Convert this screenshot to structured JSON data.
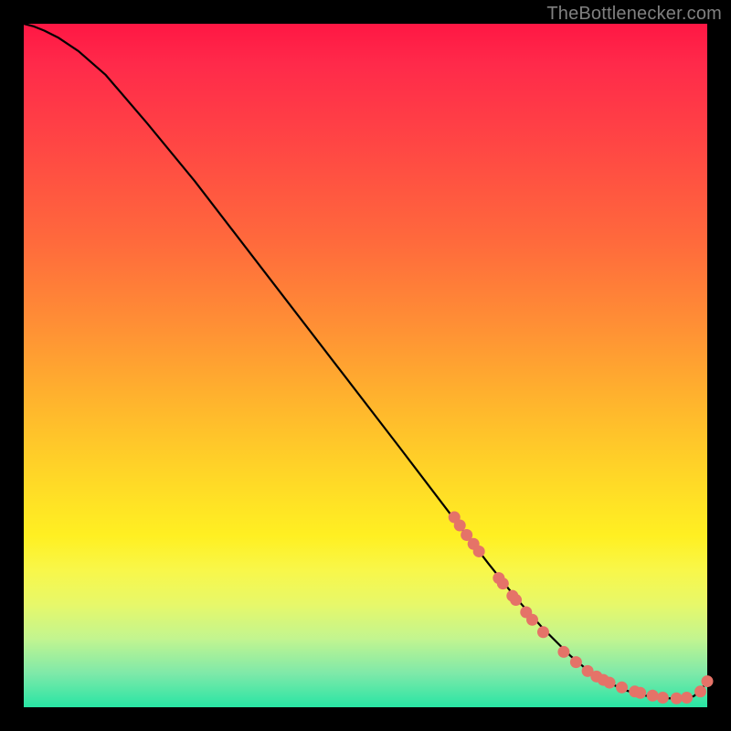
{
  "watermark": "TheBottlenecker.com",
  "colors": {
    "curve": "#000000",
    "dot_fill": "#e57368",
    "dot_stroke": "#c05a50"
  },
  "chart_data": {
    "type": "line",
    "title": "",
    "xlabel": "",
    "ylabel": "",
    "xlim": [
      0,
      100
    ],
    "ylim": [
      0,
      100
    ],
    "grid": false,
    "legend": false,
    "series": [
      {
        "name": "curve",
        "x": [
          0,
          1.5,
          3,
          5,
          8,
          12,
          18,
          25,
          35,
          45,
          55,
          63,
          68,
          72,
          76,
          80,
          83,
          86,
          88,
          90,
          92,
          94,
          96,
          98,
          99,
          100
        ],
        "y": [
          100,
          99.6,
          99.0,
          98.0,
          96.0,
          92.5,
          85.5,
          77.0,
          64.0,
          51.0,
          38.0,
          27.5,
          21.0,
          16.0,
          11.5,
          7.5,
          5.0,
          3.4,
          2.5,
          1.9,
          1.5,
          1.3,
          1.3,
          1.6,
          2.4,
          3.8
        ]
      }
    ],
    "dots": {
      "name": "markers",
      "x": [
        63.0,
        63.8,
        64.8,
        65.8,
        66.6,
        69.5,
        70.1,
        71.5,
        72.0,
        73.5,
        74.4,
        76.0,
        79.0,
        80.8,
        82.5,
        83.8,
        84.8,
        85.7,
        87.5,
        89.4,
        90.2,
        92.0,
        93.5,
        95.5,
        97.0,
        99.0,
        100.0
      ],
      "y": [
        27.8,
        26.6,
        25.2,
        23.9,
        22.8,
        18.9,
        18.1,
        16.3,
        15.7,
        13.9,
        12.8,
        11.0,
        8.1,
        6.6,
        5.3,
        4.5,
        4.0,
        3.6,
        2.9,
        2.3,
        2.1,
        1.7,
        1.4,
        1.3,
        1.4,
        2.3,
        3.8
      ]
    }
  }
}
